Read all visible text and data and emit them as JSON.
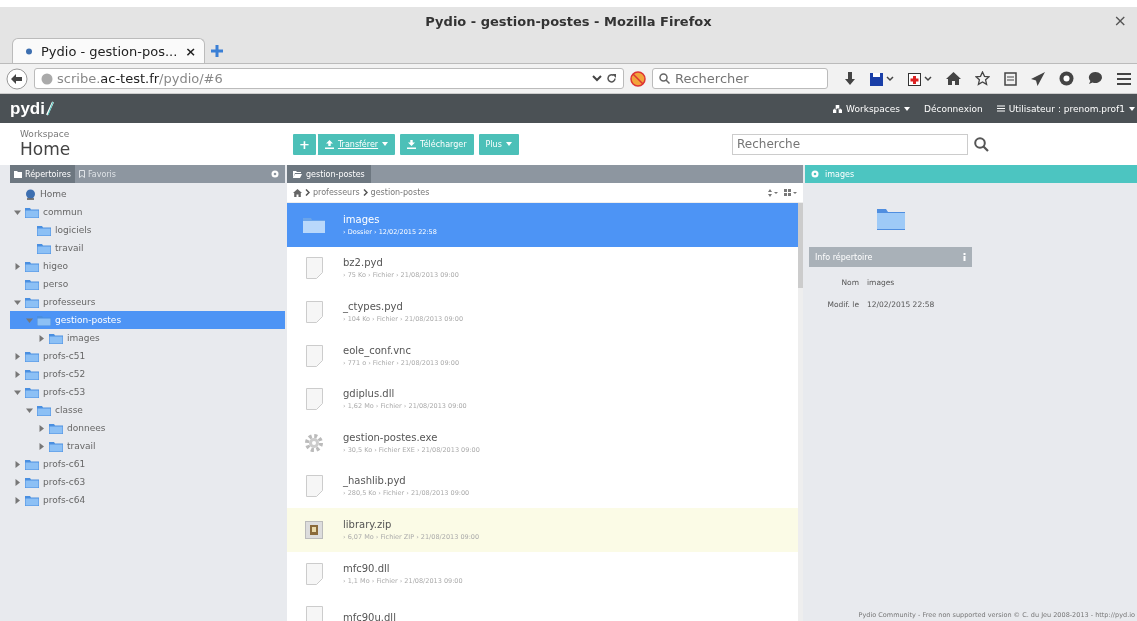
{
  "window": {
    "title": "Pydio - gestion-postes - Mozilla Firefox",
    "close": "×"
  },
  "browser_tabs": [
    {
      "label": "Pydio - gestion-pos...",
      "close": "×"
    }
  ],
  "address_bar": {
    "url": "scribe.**ac-test.fr**/pydio/#6"
  },
  "browser_search": {
    "placeholder": "Rechercher"
  },
  "app_bar": {
    "logo": "pydi",
    "workspaces": "Workspaces",
    "logout": "Déconnexion",
    "user": "Utilisateur : prenom.prof1"
  },
  "workspace": {
    "label": "Workspace",
    "name": "Home"
  },
  "actions": [
    {
      "kind": "icon",
      "label": "+"
    },
    {
      "kind": "upload",
      "label": "Transférer"
    },
    {
      "kind": "download",
      "label": "Télécharger"
    },
    {
      "kind": "menu",
      "label": "Plus"
    }
  ],
  "search": {
    "placeholder": "Recherche"
  },
  "left_tabs": [
    {
      "label": "Répertoires",
      "selected": true
    },
    {
      "label": "Favoris",
      "selected": false
    }
  ],
  "tree": [
    {
      "label": "Home",
      "kind": "root",
      "selected": false
    },
    {
      "label": "commun",
      "kind": "branch",
      "expanded": true,
      "selected": false,
      "children": [
        {
          "label": "logiciels",
          "kind": "leaf",
          "selected": false
        },
        {
          "label": "travail",
          "kind": "leaf",
          "selected": false
        }
      ]
    },
    {
      "label": "higeo",
      "kind": "branch",
      "expanded": false,
      "selected": false
    },
    {
      "label": "perso",
      "kind": "leaf",
      "selected": false
    },
    {
      "label": "professeurs",
      "kind": "branch",
      "expanded": true,
      "selected": false,
      "children": [
        {
          "label": "gestion-postes",
          "kind": "branch",
          "expanded": true,
          "selected": true,
          "children": [
            {
              "label": "images",
              "kind": "branch",
              "expanded": false,
              "selected": false
            }
          ]
        }
      ]
    },
    {
      "label": "profs-c51",
      "kind": "branch",
      "expanded": false,
      "selected": false
    },
    {
      "label": "profs-c52",
      "kind": "branch",
      "expanded": false,
      "selected": false
    },
    {
      "label": "profs-c53",
      "kind": "branch",
      "expanded": true,
      "selected": false,
      "children": [
        {
          "label": "classe",
          "kind": "branch",
          "expanded": true,
          "selected": false,
          "children": [
            {
              "label": "donnees",
              "kind": "branch",
              "expanded": false,
              "selected": false
            },
            {
              "label": "travail",
              "kind": "branch",
              "expanded": false,
              "selected": false
            }
          ]
        }
      ]
    },
    {
      "label": "profs-c61",
      "kind": "branch",
      "expanded": false,
      "selected": false
    },
    {
      "label": "profs-c63",
      "kind": "branch",
      "expanded": false,
      "selected": false
    },
    {
      "label": "profs-c64",
      "kind": "branch",
      "expanded": false,
      "selected": false
    }
  ],
  "center_tab": {
    "label": "gestion-postes"
  },
  "breadcrumb": [
    "professeurs",
    "gestion-postes"
  ],
  "files": [
    {
      "name": "images",
      "meta": "› Dossier › 12/02/2015 22:58",
      "kind": "folder",
      "selected": true,
      "highlighted": false
    },
    {
      "name": "bz2.pyd",
      "meta": "› 75 Ko › Fichier › 21/08/2013 09:00",
      "kind": "file",
      "selected": false,
      "highlighted": false
    },
    {
      "name": "_ctypes.pyd",
      "meta": "› 104 Ko › Fichier › 21/08/2013 09:00",
      "kind": "file",
      "selected": false,
      "highlighted": false
    },
    {
      "name": "eole_conf.vnc",
      "meta": "› 771 o › Fichier › 21/08/2013 09:00",
      "kind": "file",
      "selected": false,
      "highlighted": false
    },
    {
      "name": "gdiplus.dll",
      "meta": "› 1,62 Mo › Fichier › 21/08/2013 09:00",
      "kind": "file",
      "selected": false,
      "highlighted": false
    },
    {
      "name": "gestion-postes.exe",
      "meta": "› 30,5 Ko › Fichier EXE › 21/08/2013 09:00",
      "kind": "exe",
      "selected": false,
      "highlighted": false
    },
    {
      "name": "_hashlib.pyd",
      "meta": "› 280,5 Ko › Fichier › 21/08/2013 09:00",
      "kind": "file",
      "selected": false,
      "highlighted": false
    },
    {
      "name": "library.zip",
      "meta": "› 6,07 Mo › Fichier ZIP › 21/08/2013 09:00",
      "kind": "zip",
      "selected": false,
      "highlighted": true
    },
    {
      "name": "mfc90.dll",
      "meta": "› 1,1 Mo › Fichier › 21/08/2013 09:00",
      "kind": "file",
      "selected": false,
      "highlighted": false
    },
    {
      "name": "mfc90u.dll",
      "kind": "file",
      "selected": false,
      "highlighted": false
    }
  ],
  "info": {
    "header": "images",
    "section": "Info répertoire",
    "fields": [
      {
        "label": "Nom",
        "value": "images"
      },
      {
        "label": "Modif. le",
        "value": "12/02/2015 22:58"
      }
    ]
  },
  "footer": "Pydio Community - Free non supported version © C. du Jeu 2008-2013 - http://pyd.io"
}
